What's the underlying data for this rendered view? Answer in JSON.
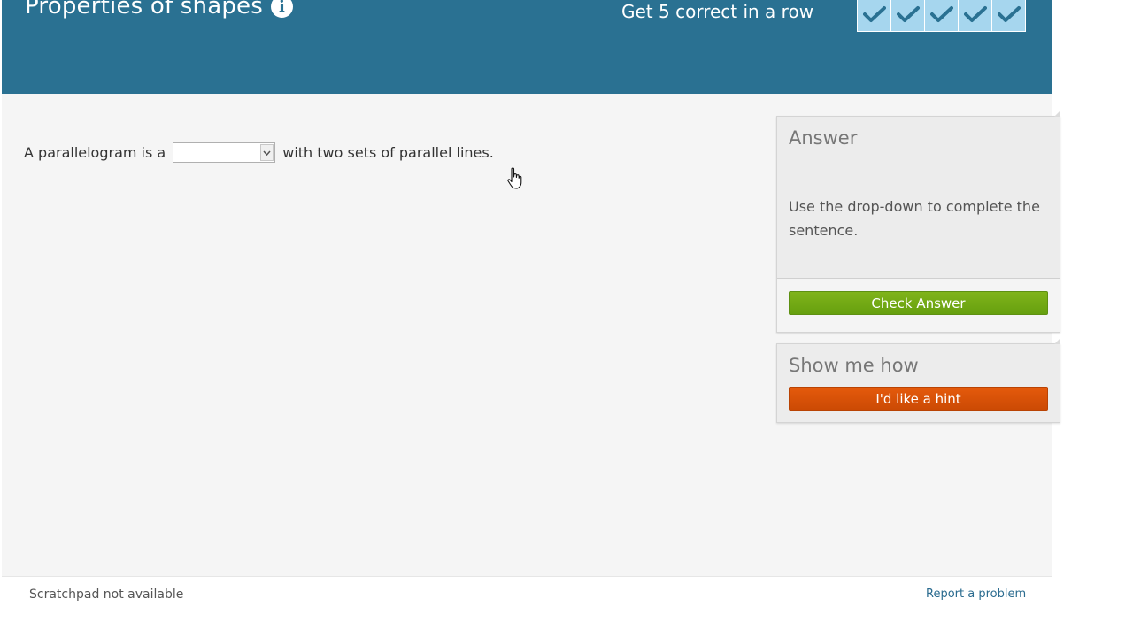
{
  "header": {
    "title": "Properties of shapes",
    "info_icon": "info-icon",
    "streak_text": "Get 5 correct in a row",
    "streak_total": 5,
    "streak_completed": 5
  },
  "question": {
    "before": "A parallelogram is a",
    "select_value": "",
    "after": "with two sets of parallel lines."
  },
  "answer_panel": {
    "title": "Answer",
    "instructions": "Use the drop-down to complete the sentence.",
    "check_button": "Check Answer"
  },
  "hint_panel": {
    "title": "Show me how",
    "hint_button": "I'd like a hint"
  },
  "footer": {
    "scratchpad": "Scratchpad not available",
    "report": "Report a problem"
  },
  "colors": {
    "header_bg": "#2a7192",
    "streak_box": "#a6d6ee",
    "check_green": "#73a916",
    "hint_orange": "#d95207"
  }
}
